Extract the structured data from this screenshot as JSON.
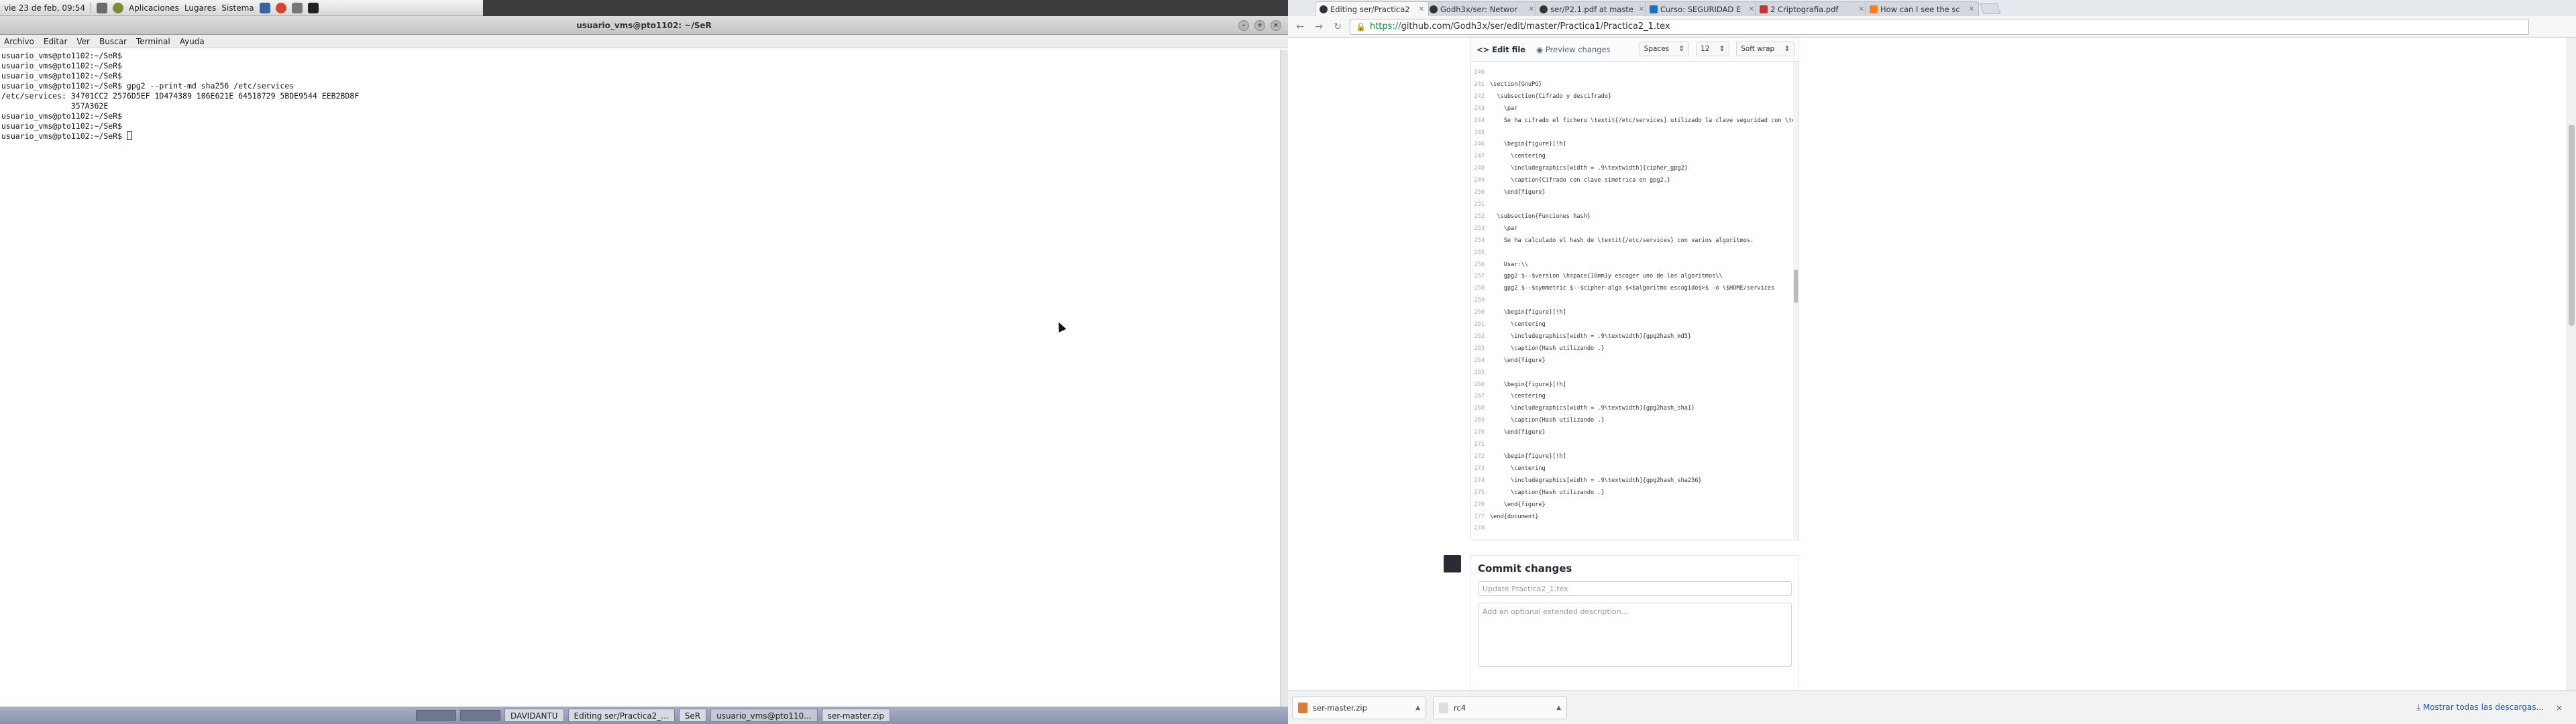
{
  "panel": {
    "datetime": "vie 23 de feb, 09:54",
    "menus": [
      "Aplicaciones",
      "Lugares",
      "Sistema"
    ]
  },
  "terminal": {
    "title": "usuario_vms@pto1102: ~/SeR",
    "menu": [
      "Archivo",
      "Editar",
      "Ver",
      "Buscar",
      "Terminal",
      "Ayuda"
    ],
    "lines": [
      "usuario_vms@pto1102:~/SeR$",
      "usuario_vms@pto1102:~/SeR$",
      "usuario_vms@pto1102:~/SeR$",
      "usuario_vms@pto1102:~/SeR$ gpg2 --print-md sha256 /etc/services",
      "/etc/services: 34701CC2 2576D5EF 1D474389 106E621E 64518729 5BDE9544 EEB2BD8F",
      "               357A362E",
      "usuario_vms@pto1102:~/SeR$",
      "usuario_vms@pto1102:~/SeR$",
      "usuario_vms@pto1102:~/SeR$ "
    ]
  },
  "taskbar": {
    "items": [
      "DAVIDANTU",
      "Editing ser/Practica2_...",
      "SeR",
      "usuario_vms@pto110...",
      "ser-master.zip"
    ]
  },
  "browser": {
    "tabs": [
      {
        "label": "Editing ser/Practica2",
        "fav": "github"
      },
      {
        "label": "Godh3x/ser: Networ",
        "fav": "github"
      },
      {
        "label": "ser/P2.1.pdf at maste",
        "fav": "github"
      },
      {
        "label": "Curso: SEGURIDAD E",
        "fav": "blue"
      },
      {
        "label": "2 Criptografia.pdf",
        "fav": "pdf"
      },
      {
        "label": "How can I see the sc",
        "fav": "so"
      }
    ],
    "url_scheme": "https://",
    "url_rest": "github.com/Godh3x/ser/edit/master/Practica1/Practica2_1.tex",
    "editor": {
      "edit_tab": "<> Edit file",
      "preview_tab": "Preview changes",
      "indent_mode": "Spaces",
      "indent_size": "12",
      "wrap_mode": "Soft wrap",
      "code": [
        {
          "n": "240",
          "t": ""
        },
        {
          "n": "241",
          "t": "\\section{GnuPG}"
        },
        {
          "n": "242",
          "t": "  \\subsection{Cifrado y descifrado}"
        },
        {
          "n": "243",
          "t": "    \\par"
        },
        {
          "n": "244",
          "t": "    Se ha cifrado el fichero \\textit{/etc/services} utilizado la clave seguridad con \\textbf{batch mode}, modo por bloques."
        },
        {
          "n": "245",
          "t": ""
        },
        {
          "n": "246",
          "t": "    \\begin{figure}[!h]"
        },
        {
          "n": "247",
          "t": "      \\centering"
        },
        {
          "n": "248",
          "t": "      \\includegraphics[width = .9\\textwidth]{cipher_gpg2}"
        },
        {
          "n": "249",
          "t": "      \\caption{Cifrado con clave simetrica en gpg2.}"
        },
        {
          "n": "250",
          "t": "    \\end{figure}"
        },
        {
          "n": "251",
          "t": ""
        },
        {
          "n": "252",
          "t": "  \\subsection{Funciones hash}"
        },
        {
          "n": "253",
          "t": "    \\par"
        },
        {
          "n": "254",
          "t": "    Se ha calculado el hash de \\textit{/etc/services} con varios algoritmos."
        },
        {
          "n": "255",
          "t": ""
        },
        {
          "n": "256",
          "t": "    Usar:\\\\"
        },
        {
          "n": "257",
          "t": "    gpg2 $--$version \\hspace{10mm}y escoger uno de los algoritmos\\\\"
        },
        {
          "n": "258",
          "t": "    gpg2 $--$symmetric $--$cipher-algo $<$algoritmo escogido$>$ -o \\$HOME/services"
        },
        {
          "n": "259",
          "t": ""
        },
        {
          "n": "260",
          "t": "    \\begin{figure}[!h]"
        },
        {
          "n": "261",
          "t": "      \\centering"
        },
        {
          "n": "262",
          "t": "      \\includegraphics[width = .9\\textwidth]{gpg2hash_md5}"
        },
        {
          "n": "263",
          "t": "      \\caption{Hash utilizando .}"
        },
        {
          "n": "264",
          "t": "    \\end{figure}"
        },
        {
          "n": "265",
          "t": ""
        },
        {
          "n": "266",
          "t": "    \\begin{figure}[!h]"
        },
        {
          "n": "267",
          "t": "      \\centering"
        },
        {
          "n": "268",
          "t": "      \\includegraphics[width = .9\\textwidth]{gpg2hash_sha1}"
        },
        {
          "n": "269",
          "t": "      \\caption{Hash utilizando .}"
        },
        {
          "n": "270",
          "t": "    \\end{figure}"
        },
        {
          "n": "271",
          "t": ""
        },
        {
          "n": "272",
          "t": "    \\begin{figure}[!h]"
        },
        {
          "n": "273",
          "t": "      \\centering"
        },
        {
          "n": "274",
          "t": "      \\includegraphics[width = .9\\textwidth]{gpg2hash_sha256}"
        },
        {
          "n": "275",
          "t": "      \\caption{Hash utilizando .}"
        },
        {
          "n": "276",
          "t": "    \\end{figure}"
        },
        {
          "n": "277",
          "t": "\\end{document}"
        },
        {
          "n": "278",
          "t": ""
        }
      ]
    },
    "commit": {
      "heading": "Commit changes",
      "summary_placeholder": "Update Practica2_1.tex",
      "description_placeholder": "Add an optional extended description..."
    },
    "downloads": {
      "items": [
        "ser-master.zip",
        "rc4"
      ],
      "show_all": "Mostrar todas las descargas..."
    }
  }
}
